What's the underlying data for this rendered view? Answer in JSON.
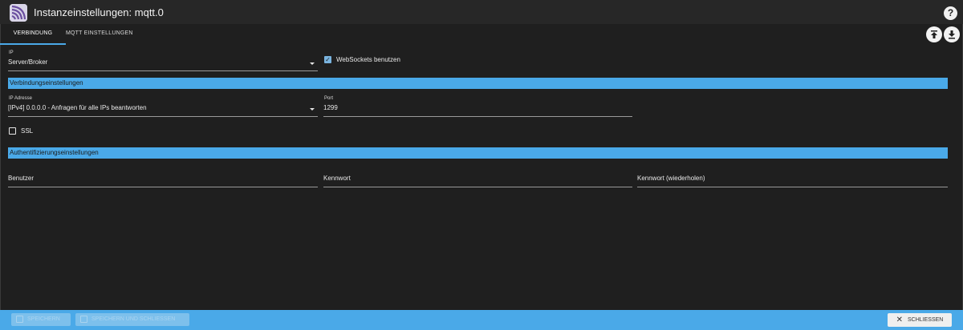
{
  "header": {
    "title": "Instanzeinstellungen: mqtt.0",
    "help_icon": "question-icon",
    "logo_icon": "mqtt-logo"
  },
  "tabs": [
    {
      "label": "VERBINDUNG",
      "active": true
    },
    {
      "label": "MQTT EINSTELLUNGEN",
      "active": false
    }
  ],
  "toolbar": {
    "upload_icon": "upload-icon",
    "download_icon": "download-icon"
  },
  "connection": {
    "ip_label": "IP",
    "type_value": "Server/Broker",
    "websockets_label": "WebSockets benutzen",
    "websockets_checked": true
  },
  "sections": {
    "connection_settings": "Verbindungseinstellungen",
    "auth_settings": "Authentifizierungseinstellungen"
  },
  "connection_settings": {
    "ip_address_label": "IP Adresse",
    "ip_address_value": "[IPv4] 0.0.0.0 - Anfragen für alle IPs beantworten",
    "port_label": "Port",
    "port_value": "1299",
    "ssl_label": "SSL",
    "ssl_checked": false
  },
  "auth": {
    "user_placeholder": "Benutzer",
    "password_placeholder": "Kennwort",
    "password_repeat_placeholder": "Kennwort (wiederholen)"
  },
  "footer": {
    "save_label": "SPEICHERN",
    "save_close_label": "SPEICHERN UND SCHLIESSEN",
    "close_label": "SCHLIESSEN"
  },
  "colors": {
    "accent": "#4aa9e8",
    "background": "#1f1f1f"
  }
}
